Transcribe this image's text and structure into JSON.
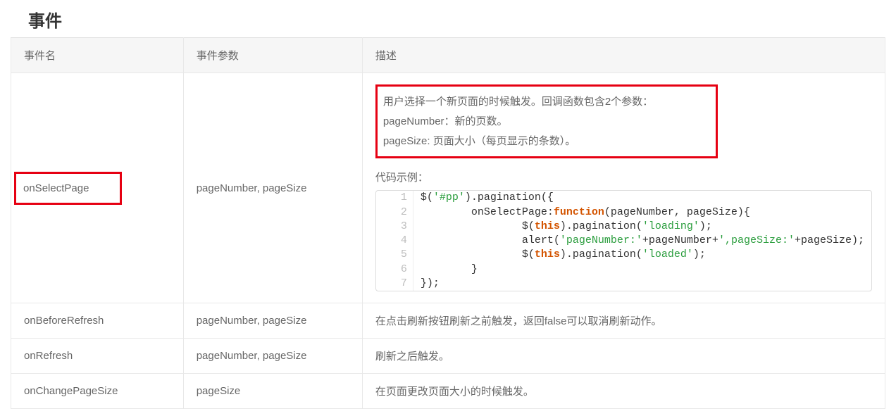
{
  "section_title": "事件",
  "table": {
    "headers": [
      "事件名",
      "事件参数",
      "描述"
    ],
    "rows": [
      {
        "name": "onSelectPage",
        "params": "pageNumber, pageSize",
        "desc_lines": [
          "用户选择一个新页面的时候触发。回调函数包含2个参数：",
          "pageNumber：新的页数。",
          "pageSize: 页面大小（每页显示的条数）。"
        ],
        "code_label": "代码示例：",
        "code": {
          "lines": [
            "$('#pp').pagination({",
            "        onSelectPage:function(pageNumber, pageSize){",
            "                $(this).pagination('loading');",
            "                alert('pageNumber:'+pageNumber+',pageSize:'+pageSize);",
            "                $(this).pagination('loaded');",
            "        }",
            "});"
          ]
        }
      },
      {
        "name": "onBeforeRefresh",
        "params": "pageNumber, pageSize",
        "desc": "在点击刷新按钮刷新之前触发，返回false可以取消刷新动作。"
      },
      {
        "name": "onRefresh",
        "params": "pageNumber, pageSize",
        "desc": "刷新之后触发。"
      },
      {
        "name": "onChangePageSize",
        "params": "pageSize",
        "desc": "在页面更改页面大小的时候触发。"
      }
    ]
  }
}
